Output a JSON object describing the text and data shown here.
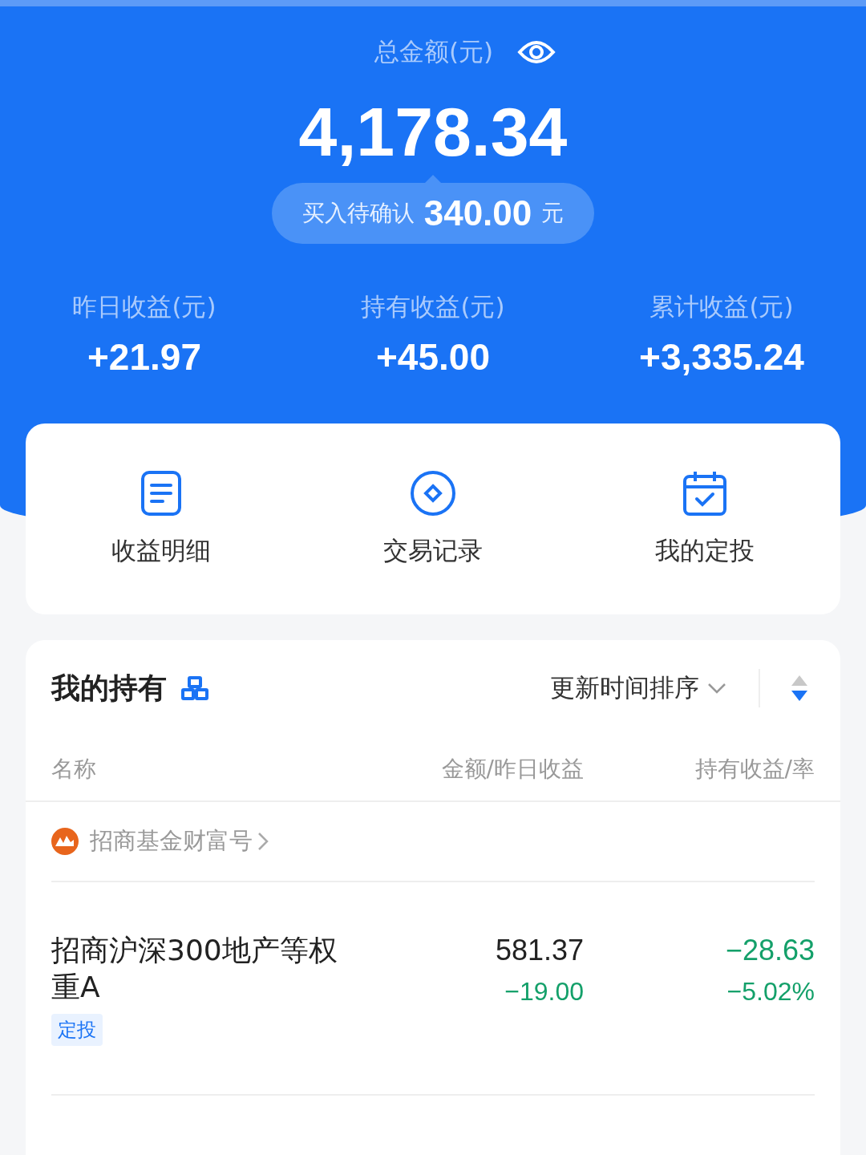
{
  "summary": {
    "label": "总金额(元)",
    "amount_visible": true,
    "amount": "4,178.34",
    "pending": {
      "label": "买入待确认",
      "amount": "340.00",
      "unit": "元"
    }
  },
  "stats": [
    {
      "label": "昨日收益(元)",
      "value": "+21.97"
    },
    {
      "label": "持有收益(元)",
      "value": "+45.00"
    },
    {
      "label": "累计收益(元)",
      "value": "+3,335.24"
    }
  ],
  "shortcuts": [
    {
      "kind": "document",
      "label": "收益明细"
    },
    {
      "kind": "record",
      "label": "交易记录"
    },
    {
      "kind": "calendar",
      "label": "我的定投"
    }
  ],
  "holdings": {
    "title": "我的持有",
    "sort": "更新时间排序",
    "sort_descending": true,
    "columns": [
      "名称",
      "金额/昨日收益",
      "持有收益/率"
    ],
    "source": "招商基金财富号",
    "rows": [
      {
        "name": "招商沪深300地产等权重A",
        "tag": "定投",
        "amount": "581.37",
        "yesterday": "−19.00",
        "gain": "−28.63",
        "rate": "−5.02%",
        "negative": true
      }
    ]
  }
}
